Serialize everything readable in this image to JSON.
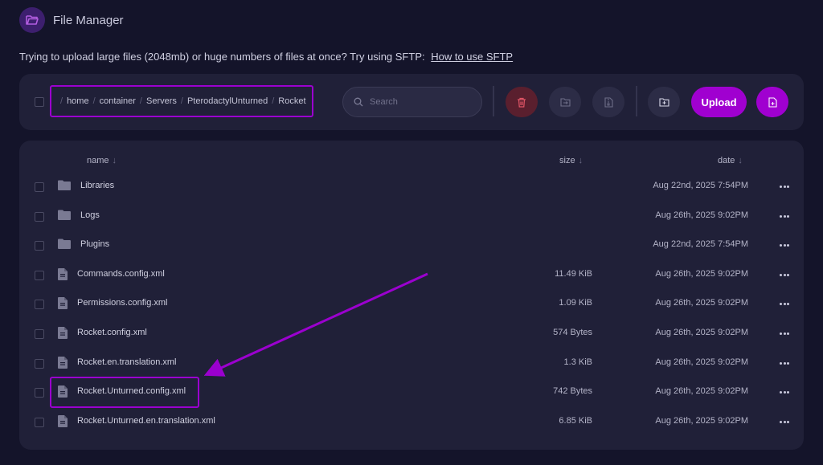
{
  "header": {
    "title": "File Manager",
    "icon": "folder-open-icon"
  },
  "notice": {
    "text": "Trying to upload large files (2048mb) or huge numbers of files at once? Try using SFTP:",
    "link_label": "How to use SFTP"
  },
  "breadcrumb": [
    "home",
    "container",
    "Servers",
    "PterodactylUnturned",
    "Rocket"
  ],
  "search": {
    "placeholder": "Search"
  },
  "toolbar": {
    "upload_label": "Upload",
    "icons": [
      "trash-icon",
      "move-folder-icon",
      "archive-file-icon",
      "new-folder-icon",
      "new-file-icon"
    ]
  },
  "table": {
    "headers": {
      "name": "name",
      "size": "size",
      "date": "date"
    },
    "rows": [
      {
        "type": "folder",
        "name": "Libraries",
        "size": "",
        "date": "Aug 22nd, 2025 7:54PM"
      },
      {
        "type": "folder",
        "name": "Logs",
        "size": "",
        "date": "Aug 26th, 2025 9:02PM"
      },
      {
        "type": "folder",
        "name": "Plugins",
        "size": "",
        "date": "Aug 22nd, 2025 7:54PM"
      },
      {
        "type": "file",
        "name": "Commands.config.xml",
        "size": "11.49 KiB",
        "date": "Aug 26th, 2025 9:02PM"
      },
      {
        "type": "file",
        "name": "Permissions.config.xml",
        "size": "1.09 KiB",
        "date": "Aug 26th, 2025 9:02PM"
      },
      {
        "type": "file",
        "name": "Rocket.config.xml",
        "size": "574 Bytes",
        "date": "Aug 26th, 2025 9:02PM"
      },
      {
        "type": "file",
        "name": "Rocket.en.translation.xml",
        "size": "1.3 KiB",
        "date": "Aug 26th, 2025 9:02PM"
      },
      {
        "type": "file",
        "name": "Rocket.Unturned.config.xml",
        "size": "742 Bytes",
        "date": "Aug 26th, 2025 9:02PM"
      },
      {
        "type": "file",
        "name": "Rocket.Unturned.en.translation.xml",
        "size": "6.85 KiB",
        "date": "Aug 26th, 2025 9:02PM"
      }
    ]
  },
  "colors": {
    "accent": "#a000d0",
    "highlight": "#9b00cf",
    "danger": "#5a1f2e",
    "background": "#14142a",
    "panel": "#202038"
  }
}
